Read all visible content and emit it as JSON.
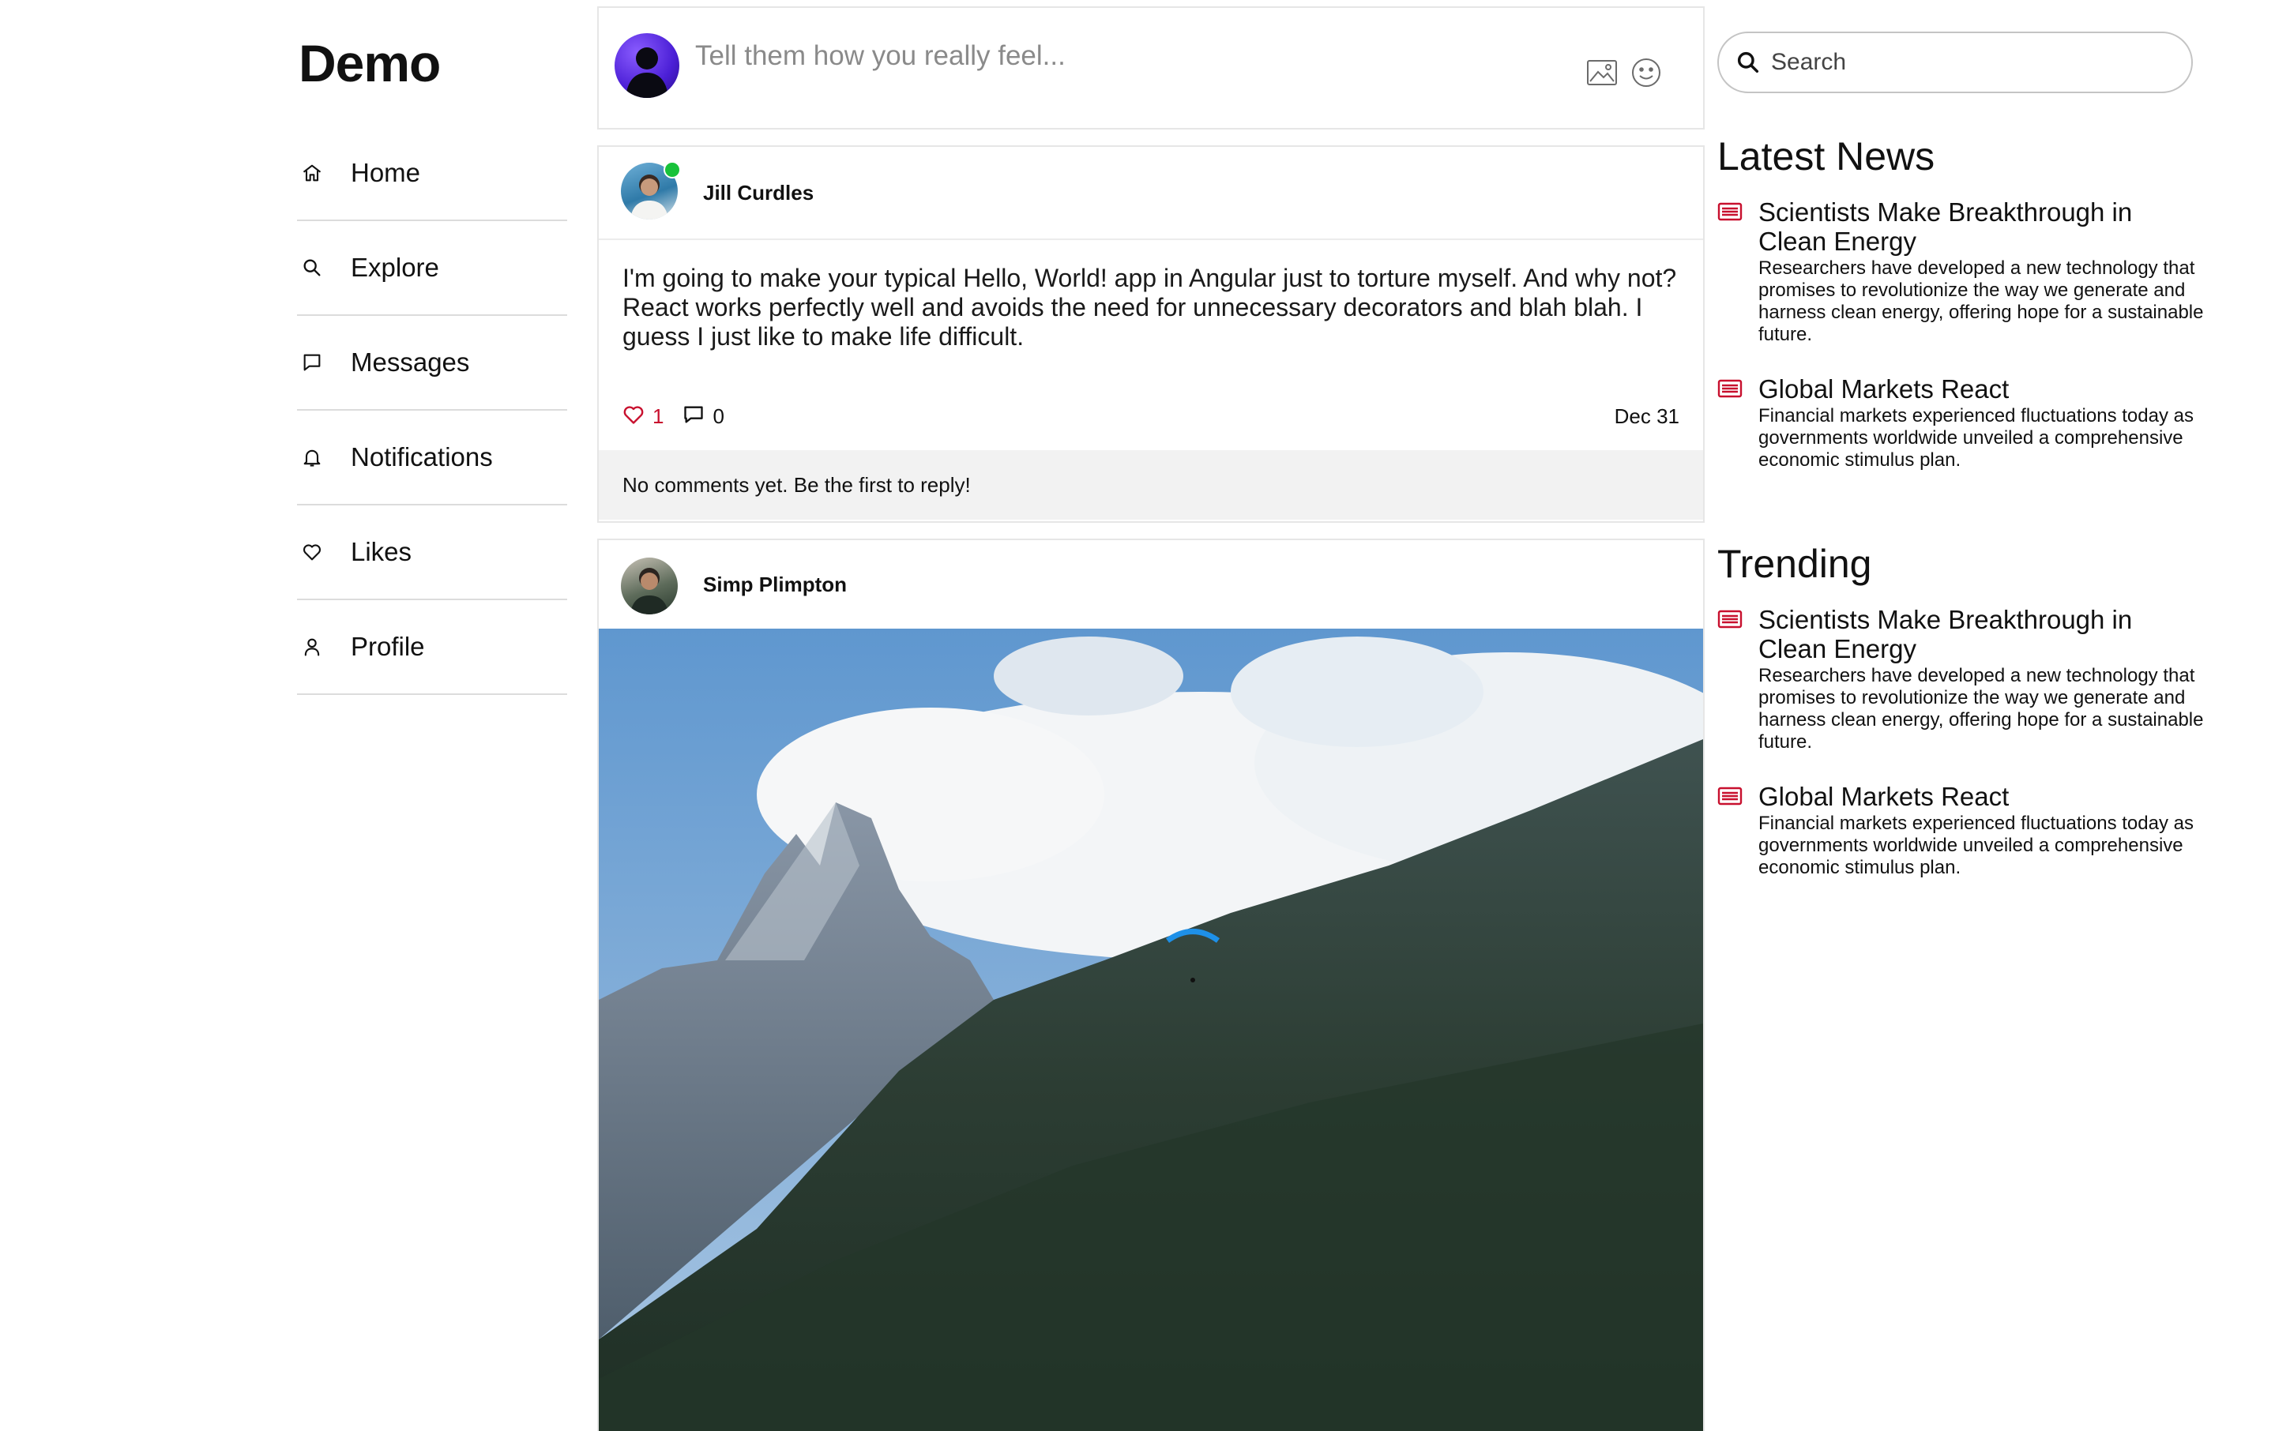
{
  "app": {
    "logo": "Demo"
  },
  "nav": {
    "items": [
      {
        "label": "Home",
        "icon": "home-icon"
      },
      {
        "label": "Explore",
        "icon": "search-icon"
      },
      {
        "label": "Messages",
        "icon": "message-icon"
      },
      {
        "label": "Notifications",
        "icon": "bell-icon"
      },
      {
        "label": "Likes",
        "icon": "heart-icon"
      },
      {
        "label": "Profile",
        "icon": "user-icon"
      }
    ]
  },
  "compose": {
    "placeholder": "Tell them how you really feel...",
    "actions": [
      "image-icon",
      "emoji-icon"
    ]
  },
  "posts": [
    {
      "author": "Jill Curdles",
      "online": true,
      "text": "I'm going to make your typical Hello, World! app in Angular just to torture myself. And why not? React works perfectly well and avoids the need for unnecessary decorators and blah blah. I guess I just like to make life difficult.",
      "likes": "1",
      "comments": "0",
      "date": "Dec 31",
      "comments_empty": "No comments yet. Be the first to reply!"
    },
    {
      "author": "Simp Plimpton",
      "image": "mountain-landscape-with-paraglider"
    }
  ],
  "search": {
    "placeholder": "Search"
  },
  "latest_news": {
    "title": "Latest News",
    "items": [
      {
        "title": "Scientists Make Breakthrough in Clean Energy",
        "description": "Researchers have developed a new technology that promises to revolutionize the way we generate and harness clean energy, offering hope for a sustainable future."
      },
      {
        "title": "Global Markets React",
        "description": "Financial markets experienced fluctuations today as governments worldwide unveiled a comprehensive economic stimulus plan."
      }
    ]
  },
  "trending": {
    "title": "Trending",
    "items": [
      {
        "title": "Scientists Make Breakthrough in Clean Energy",
        "description": "Researchers have developed a new technology that promises to revolutionize the way we generate and harness clean energy, offering hope for a sustainable future."
      },
      {
        "title": "Global Markets React",
        "description": "Financial markets experienced fluctuations today as governments worldwide unveiled a comprehensive economic stimulus plan."
      }
    ]
  },
  "colors": {
    "accent": "#c8102e",
    "online": "#18c23a",
    "border": "#e6e6e6",
    "comment_bg": "#f2f2f2"
  }
}
